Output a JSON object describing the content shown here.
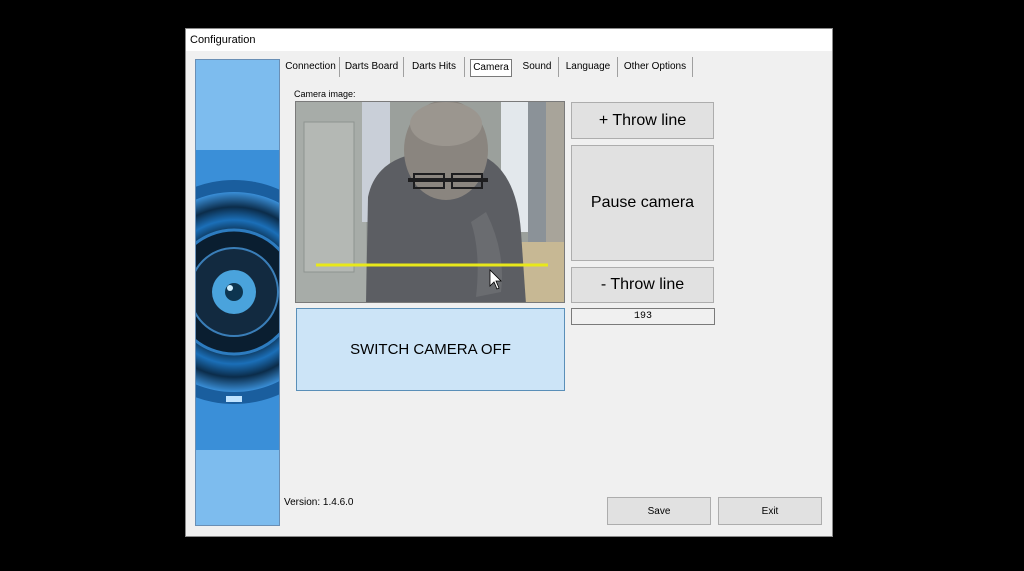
{
  "window": {
    "title": "Configuration"
  },
  "tabs": [
    {
      "label": "Connection"
    },
    {
      "label": "Darts Board"
    },
    {
      "label": "Darts Hits"
    },
    {
      "label": "Camera",
      "active": true
    },
    {
      "label": "Sound"
    },
    {
      "label": "Language"
    },
    {
      "label": "Other Options"
    }
  ],
  "camera": {
    "caption": "Camera image:",
    "throw_line_color": "#e8e81a",
    "throw_line_plus_label": "+ Throw line",
    "pause_label": "Pause camera",
    "throw_line_minus_label": "- Throw line",
    "throw_line_value": "193",
    "switch_label": "SWITCH CAMERA OFF",
    "switch_color": "#cce4f7"
  },
  "footer": {
    "version": "Version: 1.4.6.0",
    "save_label": "Save",
    "exit_label": "Exit"
  },
  "colors": {
    "accent": "#1f6fb8",
    "window_bg": "#f0f0f0"
  }
}
